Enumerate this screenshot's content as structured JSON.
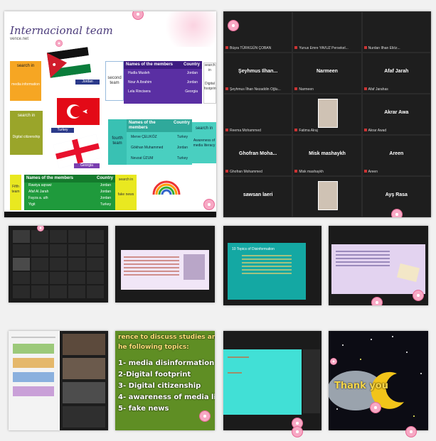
{
  "tileA": {
    "title": "Internacional team",
    "subtitle": "vence.net",
    "country_labels": {
      "jordan": "Jordan",
      "turkey": "Turkey",
      "georgia": "Georgia"
    },
    "search_left": "search in",
    "search_left2": "media information",
    "search_mid": "search in",
    "search_mid2": "Digital citizenship",
    "team_second": "second team",
    "team_fourth": "fourth team",
    "team_fifth": "Fifth team",
    "table_second": {
      "headers": [
        "Names of the members",
        "Country"
      ],
      "rows": [
        [
          "Hudla Musleh",
          "Jordan"
        ],
        [
          "Nour A.Ibrahim",
          "Jordan"
        ],
        [
          "Lela Rincisera",
          "Georgia"
        ]
      ],
      "side": "search in",
      "side2": "Digital footprint"
    },
    "table_fourth": {
      "headers": [
        "Names of the members",
        "Country"
      ],
      "rows": [
        [
          "Merve ÇELIKÖZ",
          "Turkey"
        ],
        [
          "Gökhan Muhammed",
          "Jordan"
        ],
        [
          "Nevzat ÜZUM",
          "Turkey"
        ]
      ],
      "side": "search in",
      "side2": "Awareness of media literacy"
    },
    "table_fifth": {
      "headers": [
        "Names of the members",
        "Country"
      ],
      "rows": [
        [
          "Rawiya aqrawi",
          "Jordan"
        ],
        [
          "Afaf Al Jarah",
          "Jordan"
        ],
        [
          "Fayza a. uth",
          "Jordan"
        ],
        [
          "Yigit",
          "Turkey"
        ]
      ],
      "side": "search in",
      "side2": "fake news"
    }
  },
  "tileB": {
    "participants": [
      {
        "name": "",
        "foot": "Büşra TÜRKGÜN ÇOBAN"
      },
      {
        "name": "",
        "foot": "Yunus Emre YAVUZ Persekel..."
      },
      {
        "name": "",
        "foot": "Nurdan Ilhan Eliöz..."
      },
      {
        "name": "Şeyhmus Ilhan...",
        "foot": "Şeyhmus İlhan Nezaddin Oğlu..."
      },
      {
        "name": "Narmeen",
        "foot": "Narmeen"
      },
      {
        "name": "Afaf Jarah",
        "foot": "Afaf Jarahas"
      },
      {
        "name": "",
        "foot": "Reema Mohammed"
      },
      {
        "name": "",
        "foot": "Fatima Alraj"
      },
      {
        "name": "Akrar Awa",
        "foot": "Akrar Awad"
      },
      {
        "name": "Ghofran Moha...",
        "foot": "Ghofran Mohammed"
      },
      {
        "name": "Misk mashaykh",
        "foot": "Misk mashaykh"
      },
      {
        "name": "Areen",
        "foot": "Areen"
      },
      {
        "name": "sawsan laeri",
        "foot": ""
      },
      {
        "name": "",
        "foot": ""
      },
      {
        "name": "Ayş Rasa",
        "foot": ""
      }
    ]
  },
  "tile_slides": {
    "teal_title": "10 Topics of Disinformation",
    "green_lines": [
      "rence to discuss studies and re",
      "he following topics:",
      "1- media disinformation",
      "2-Digital footprint",
      "3- Digital citizenship",
      "4- awareness of media li",
      "5- fake news"
    ],
    "thank_you": "Thank you"
  }
}
